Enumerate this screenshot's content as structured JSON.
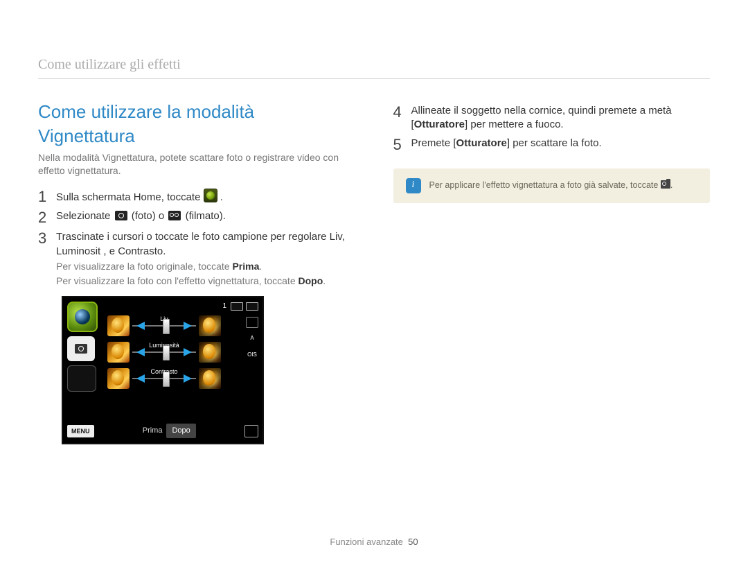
{
  "running_head": "Come utilizzare gli effetti",
  "section_title": "Come utilizzare la modalità Vignettatura",
  "intro": "Nella modalità Vignettatura, potete scattare foto o registrare video con effetto vignettatura.",
  "steps_left": [
    {
      "n": "1",
      "text": "Sulla schermata Home, toccate ",
      "trailing_icon": "app-icon",
      "suffix": "."
    },
    {
      "n": "2",
      "prefix": "Selezionate ",
      "mid1_icon": "cam-icon",
      "mid1": " (foto) o ",
      "mid2_icon": "vid-icon",
      "mid2": " (filmato)."
    },
    {
      "n": "3",
      "text": "Trascinate i cursori o toccate le foto campione per regolare Liv, Luminosit , e Contrasto.",
      "subs": [
        {
          "pre": "Per visualizzare la foto originale, toccate ",
          "bold": "Prima",
          "post": "."
        },
        {
          "pre": "Per visualizzare la foto con l'effetto vignettatura, toccate ",
          "bold": "Dopo",
          "post": "."
        }
      ]
    }
  ],
  "steps_right": [
    {
      "n": "4",
      "pre": "Allineate il soggetto nella cornice, quindi premete a metà [",
      "bold": "Otturatore",
      "post": "] per mettere a fuoco."
    },
    {
      "n": "5",
      "pre": "Premete [",
      "bold": "Otturatore",
      "post": "] per scattare la foto."
    }
  ],
  "note": {
    "badge": "i",
    "text_pre": "Per applicare l'effetto vignettatura a foto già salvate, toccate ",
    "text_post": "."
  },
  "device": {
    "count": "1",
    "right_label": "A",
    "ois_label": "OIS",
    "sliders": [
      {
        "label": "Liv"
      },
      {
        "label": "Luminosità"
      },
      {
        "label": "Contrasto"
      }
    ],
    "menu": "MENU",
    "before": "Prima",
    "after": "Dopo"
  },
  "footer": {
    "section": "Funzioni avanzate",
    "page": "50"
  }
}
